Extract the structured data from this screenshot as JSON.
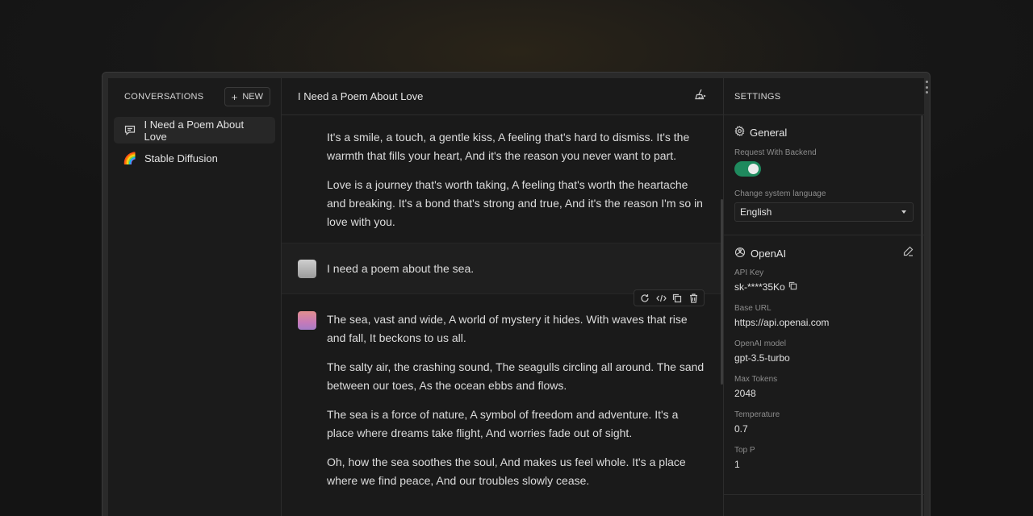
{
  "sidebar": {
    "title": "CONVERSATIONS",
    "new_label": "NEW",
    "items": [
      {
        "label": "I Need a Poem About Love",
        "icon": "chat-bubble-icon"
      },
      {
        "label": "Stable Diffusion",
        "icon": "rainbow-icon",
        "emoji": "🌈"
      }
    ]
  },
  "main": {
    "title": "I Need a Poem About Love",
    "messages": {
      "ai1": [
        "It's a smile, a touch, a gentle kiss, A feeling that's hard to dismiss. It's the warmth that fills your heart, And it's the reason you never want to part.",
        "Love is a journey that's worth taking, A feeling that's worth the heartache and breaking. It's a bond that's strong and true, And it's the reason I'm so in love with you."
      ],
      "user": "I need a poem about the sea.",
      "ai2": [
        "The sea, vast and wide, A world of mystery it hides. With waves that rise and fall, It beckons to us all.",
        "The salty air, the crashing sound, The seagulls circling all around. The sand between our toes, As the ocean ebbs and flows.",
        "The sea is a force of nature, A symbol of freedom and adventure. It's a place where dreams take flight, And worries fade out of sight.",
        "Oh, how the sea soothes the soul, And makes us feel whole. It's a place where we find peace, And our troubles slowly cease."
      ]
    }
  },
  "settings": {
    "title": "SETTINGS",
    "general": {
      "title": "General",
      "backend_label": "Request With Backend",
      "backend_enabled": true,
      "language_label": "Change system language",
      "language_value": "English"
    },
    "openai": {
      "title": "OpenAI",
      "api_key_label": "API Key",
      "api_key_value": "sk-****35Ko",
      "base_url_label": "Base URL",
      "base_url_value": "https://api.openai.com",
      "model_label": "OpenAI model",
      "model_value": "gpt-3.5-turbo",
      "max_tokens_label": "Max Tokens",
      "max_tokens_value": "2048",
      "temperature_label": "Temperature",
      "temperature_value": "0.7",
      "top_p_label": "Top P",
      "top_p_value": "1"
    }
  },
  "colors": {
    "accent_toggle": "#1f8a5e",
    "background": "#1a1a1a"
  }
}
